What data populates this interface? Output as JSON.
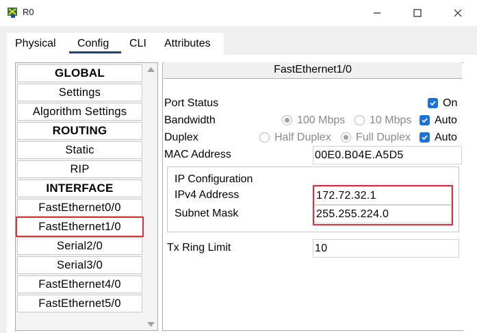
{
  "window": {
    "title": "R0",
    "icons": {
      "app": "router-app-icon",
      "minimize": "minimize-icon",
      "maximize": "maximize-icon",
      "close": "close-icon"
    }
  },
  "tabs": [
    {
      "label": "Physical"
    },
    {
      "label": "Config"
    },
    {
      "label": "CLI"
    },
    {
      "label": "Attributes"
    }
  ],
  "active_tab": "Config",
  "sidebar": {
    "items": [
      {
        "label": "GLOBAL"
      },
      {
        "label": "Settings"
      },
      {
        "label": "Algorithm Settings"
      },
      {
        "label": "ROUTING"
      },
      {
        "label": "Static"
      },
      {
        "label": "RIP"
      },
      {
        "label": "INTERFACE"
      },
      {
        "label": "FastEthernet0/0"
      },
      {
        "label": "FastEthernet1/0"
      },
      {
        "label": "Serial2/0"
      },
      {
        "label": "Serial3/0"
      },
      {
        "label": "FastEthernet4/0"
      },
      {
        "label": "FastEthernet5/0"
      }
    ],
    "selected": "FastEthernet1/0"
  },
  "interface": {
    "title": "FastEthernet1/0",
    "port_status": {
      "label": "Port Status",
      "on_label": "On",
      "checked": true
    },
    "bandwidth": {
      "label": "Bandwidth",
      "opt1": "100 Mbps",
      "opt2": "10 Mbps",
      "auto_label": "Auto",
      "auto_checked": true
    },
    "duplex": {
      "label": "Duplex",
      "opt1": "Half Duplex",
      "opt2": "Full Duplex",
      "auto_label": "Auto",
      "auto_checked": true
    },
    "mac": {
      "label": "MAC Address",
      "value": "00E0.B04E.A5D5"
    },
    "ip_config": {
      "title": "IP Configuration",
      "ipv4_label": "IPv4 Address",
      "ipv4_value": "172.72.32.1",
      "mask_label": "Subnet Mask",
      "mask_value": "255.255.224.0"
    },
    "tx_ring": {
      "label": "Tx Ring Limit",
      "value": "10"
    }
  },
  "colors": {
    "highlight": "#d9343b",
    "checkbox": "#1a73d9",
    "tab_underline": "#1d3c78"
  }
}
